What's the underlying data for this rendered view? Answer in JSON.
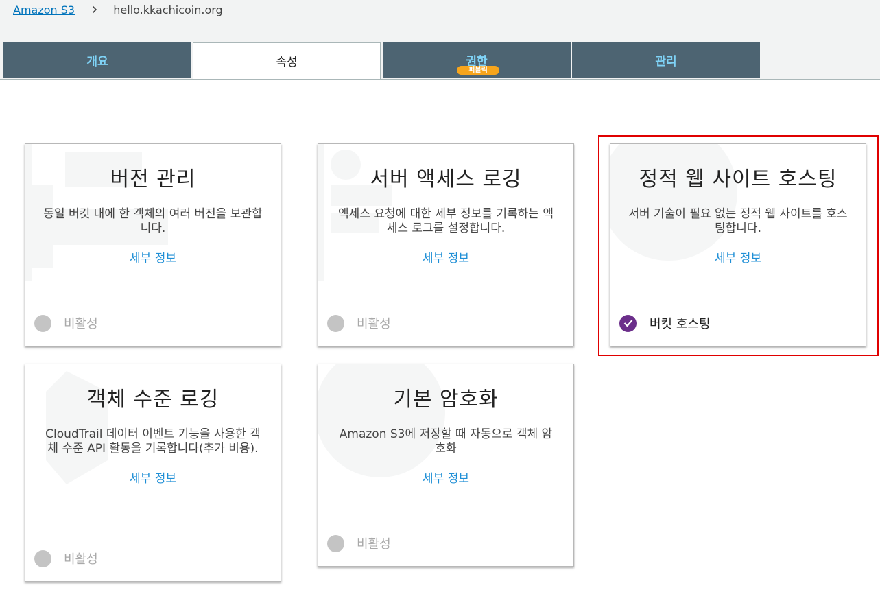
{
  "breadcrumb": {
    "root": "Amazon S3",
    "current": "hello.kkachicoin.org"
  },
  "tabs": [
    {
      "label": "개요",
      "active": false
    },
    {
      "label": "속성",
      "active": true
    },
    {
      "label": "권한",
      "active": false,
      "badge": "퍼블릭"
    },
    {
      "label": "관리",
      "active": false
    }
  ],
  "cards": {
    "versioning": {
      "title": "버전 관리",
      "description": "동일 버킷 내에 한 객체의 여러 버전을 보관합니다.",
      "link": "세부 정보",
      "status": "비활성"
    },
    "server_access_logging": {
      "title": "서버 액세스 로깅",
      "description": "액세스 요청에 대한 세부 정보를 기록하는 액세스 로그를 설정합니다.",
      "link": "세부 정보",
      "status": "비활성"
    },
    "static_website_hosting": {
      "title": "정적 웹 사이트 호스팅",
      "description": "서버 기술이 필요 없는 정적 웹 사이트를 호스팅합니다.",
      "link": "세부 정보",
      "status": "버킷 호스팅"
    },
    "object_level_logging": {
      "title": "객체 수준 로깅",
      "description": "CloudTrail 데이터 이벤트 기능을 사용한 객체 수준 API 활동을 기록합니다(추가 비용).",
      "link": "세부 정보",
      "status": "비활성"
    },
    "default_encryption": {
      "title": "기본 암호화",
      "description": "Amazon S3에 저장할 때 자동으로 객체 암호화",
      "link": "세부 정보",
      "status": "비활성"
    }
  },
  "colors": {
    "tab_bg": "#4d6472",
    "tab_text": "#7fd3f7",
    "link": "#1f8fd6",
    "badge": "#f7a51c",
    "enabled_check": "#6b2e8a",
    "highlight": "#e00000"
  }
}
